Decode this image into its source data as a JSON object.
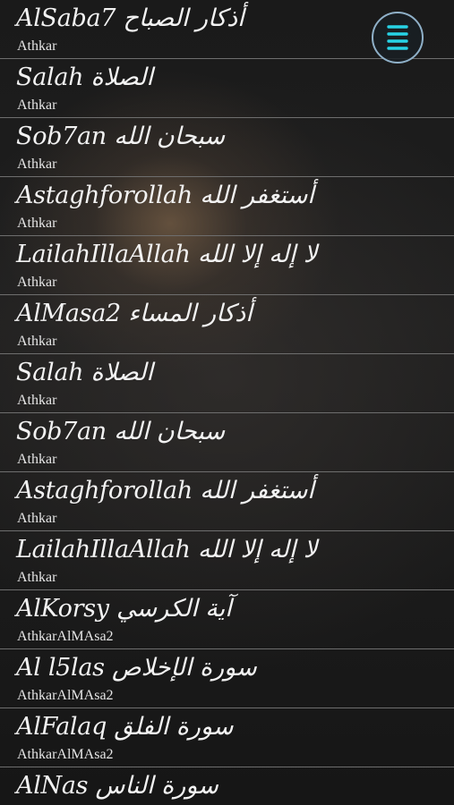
{
  "items": [
    {
      "title": "AlSaba7 أذكار الصباح",
      "subtitle": "Athkar"
    },
    {
      "title": "Salah الصلاة",
      "subtitle": "Athkar"
    },
    {
      "title": "Sob7an سبحان الله",
      "subtitle": "Athkar"
    },
    {
      "title": "Astaghforollah أستغفر الله",
      "subtitle": "Athkar"
    },
    {
      "title": "LailahIllaAllah لا إله إلا الله",
      "subtitle": "Athkar"
    },
    {
      "title": "AlMasa2 أذكار المساء",
      "subtitle": "Athkar"
    },
    {
      "title": "Salah الصلاة",
      "subtitle": "Athkar"
    },
    {
      "title": "Sob7an سبحان الله",
      "subtitle": "Athkar"
    },
    {
      "title": "Astaghforollah أستغفر الله",
      "subtitle": "Athkar"
    },
    {
      "title": "LailahIllaAllah لا إله إلا الله",
      "subtitle": "Athkar"
    },
    {
      "title": "AlKorsy آية الكرسي",
      "subtitle": "AthkarAlMAsa2"
    },
    {
      "title": "Al l5las سورة الإخلاص",
      "subtitle": "AthkarAlMAsa2"
    },
    {
      "title": "AlFalaq سورة الفلق",
      "subtitle": "AthkarAlMAsa2"
    },
    {
      "title": "AlNas سورة الناس",
      "subtitle": ""
    }
  ],
  "menu_button": {
    "icon": "hamburger-menu-icon",
    "icon_color": "#27d3e6",
    "border_color": "#8fb0c8"
  }
}
